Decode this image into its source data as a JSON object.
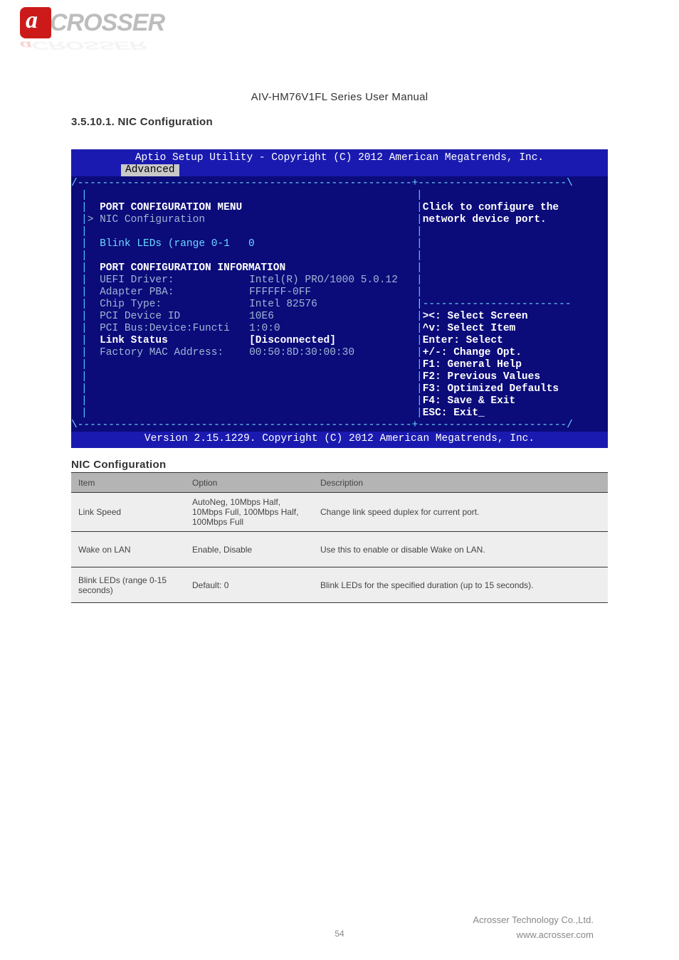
{
  "logo": {
    "brand_rest": "CROSSER"
  },
  "manual_title": "AIV-HM76V1FL Series User Manual",
  "section_heading": "3.5.10.1. NIC Configuration",
  "bios": {
    "title_line": "Aptio Setup Utility - Copyright (C) 2012 American Megatrends, Inc.",
    "tab": "Advanced",
    "top_border": "/------------------------------------------------------+------------------------\\",
    "left": {
      "menu_title": "PORT CONFIGURATION MENU",
      "nic_item": "NIC Configuration",
      "blink": {
        "label": "Blink LEDs (range 0-1",
        "value": "0"
      },
      "info_title": "PORT CONFIGURATION INFORMATION",
      "rows": [
        {
          "label": "UEFI Driver:",
          "value": "Intel(R) PRO/1000 5.0.12",
          "cls": "gray"
        },
        {
          "label": "Adapter PBA:",
          "value": "FFFFFF-0FF",
          "cls": "gray"
        },
        {
          "label": "Chip Type:",
          "value": "Intel 82576",
          "cls": "gray"
        },
        {
          "label": "PCI Device ID",
          "value": "10E6",
          "cls": "gray"
        },
        {
          "label": "PCI Bus:Device:Functi",
          "value": "1:0:0",
          "cls": "gray"
        },
        {
          "label": "Link Status",
          "value": "[Disconnected]",
          "cls": "white"
        },
        {
          "label": "Factory MAC Address:",
          "value": "00:50:8D:30:00:30",
          "cls": "gray"
        }
      ]
    },
    "right": {
      "help1": "Click to configure the",
      "help2": "network device port.",
      "mid_dash": "|------------------------",
      "keys": [
        "><: Select Screen",
        "^v: Select Item",
        "Enter: Select",
        "+/-: Change Opt.",
        "F1: General Help",
        "F2: Previous Values",
        "F3: Optimized Defaults",
        "F4: Save & Exit",
        "ESC: Exit_"
      ]
    },
    "bottom_border": "\\------------------------------------------------------+------------------------/",
    "footer": "Version 2.15.1229. Copyright (C) 2012 American Megatrends, Inc."
  },
  "nic_table": {
    "heading": "NIC Configuration",
    "headers": [
      "Item",
      "Option",
      "Description"
    ],
    "rows": [
      {
        "item": "Link Speed",
        "option": "AutoNeg, 10Mbps Half, 10Mbps Full, 100Mbps Half, 100Mbps Full",
        "desc": "Change link speed duplex for current port."
      },
      {
        "item": "Wake on LAN",
        "option": "Enable, Disable",
        "desc": "Use this to enable or disable Wake on LAN."
      },
      {
        "item": "Blink LEDs (range 0-15 seconds)",
        "option": "Default: 0",
        "desc": "Blink LEDs for the specified duration (up to 15 seconds)."
      }
    ]
  },
  "footer": {
    "company": "Acrosser Technology Co.,Ltd.",
    "url": "www.acrosser.com"
  },
  "page_number": "54"
}
